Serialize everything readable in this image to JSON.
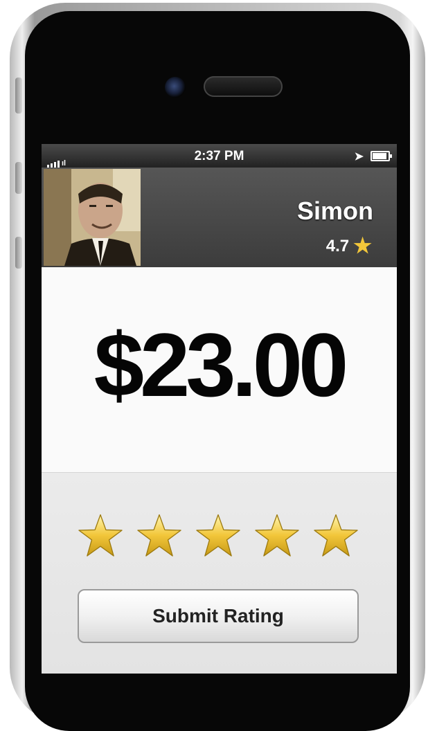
{
  "status_bar": {
    "time": "2:37 PM",
    "icons": [
      "signal-icon",
      "location-arrow-icon",
      "battery-icon"
    ]
  },
  "driver": {
    "name": "Simon",
    "rating": "4.7",
    "rating_icon": "star-icon"
  },
  "fare": {
    "amount": "$23.00"
  },
  "rating_input": {
    "max_stars": 5,
    "selected_stars": 5
  },
  "actions": {
    "submit_label": "Submit Rating"
  },
  "colors": {
    "star": "#f2c63a",
    "header_bg": "#484848",
    "fare_bg": "#fafafa",
    "rating_bg": "#e8e8e8"
  }
}
